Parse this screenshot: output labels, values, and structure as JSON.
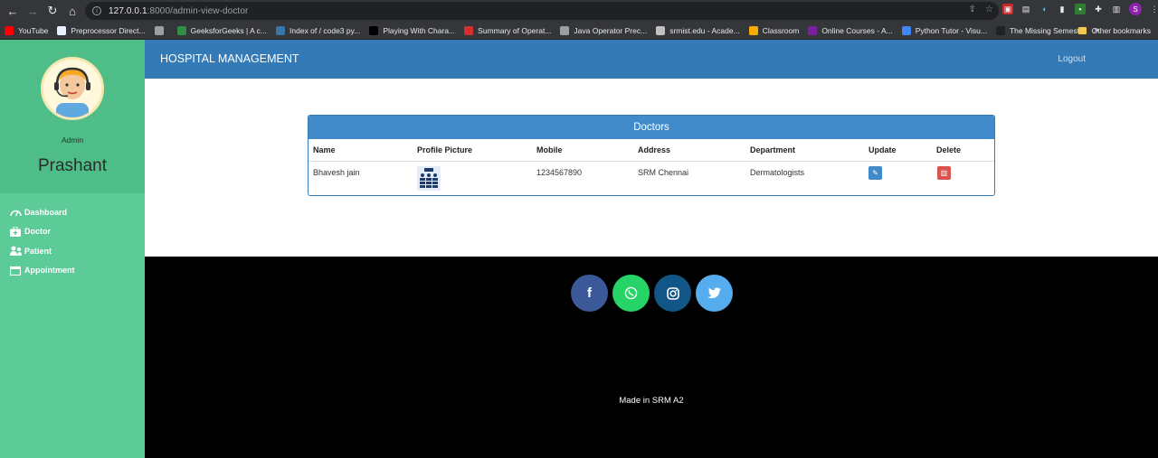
{
  "browser": {
    "url_host": "127.0.0.1",
    "url_path": ":8000/admin-view-doctor",
    "bookmarks": [
      {
        "label": "YouTube",
        "color": "#ff0000"
      },
      {
        "label": "Preprocessor Direct...",
        "color": "#e8f0fe"
      },
      {
        "label": "",
        "color": "#9aa0a6"
      },
      {
        "label": "GeeksforGeeks | A c...",
        "color": "#2f8d46"
      },
      {
        "label": "Index of / code3 py...",
        "color": "#3776ab"
      },
      {
        "label": "Playing With Chara...",
        "color": "#000000"
      },
      {
        "label": "Summary of Operat...",
        "color": "#d32f2f"
      },
      {
        "label": "Java Operator Prec...",
        "color": "#9aa0a6"
      },
      {
        "label": "srmist.edu - Acade...",
        "color": "#c0c0c0"
      },
      {
        "label": "Classroom",
        "color": "#f9ab00"
      },
      {
        "label": "Online Courses - A...",
        "color": "#7b1fa2"
      },
      {
        "label": "Python Tutor - Visu...",
        "color": "#4285f4"
      },
      {
        "label": "The Missing Semest...",
        "color": "#202124"
      }
    ],
    "other_bookmarks": "Other bookmarks",
    "profile_initial": "S"
  },
  "sidebar": {
    "role": "Admin",
    "user_name": "Prashant",
    "items": [
      {
        "label": "Dashboard"
      },
      {
        "label": "Doctor"
      },
      {
        "label": "Patient"
      },
      {
        "label": "Appointment"
      }
    ]
  },
  "header": {
    "brand": "HOSPITAL MANAGEMENT",
    "logout": "Logout"
  },
  "panel": {
    "title": "Doctors",
    "columns": [
      "Name",
      "Profile Picture",
      "Mobile",
      "Address",
      "Department",
      "Update",
      "Delete"
    ],
    "rows": [
      {
        "name": "Bhavesh jain",
        "mobile": "1234567890",
        "address": "SRM Chennai",
        "department": "Dermatologists"
      }
    ]
  },
  "footer": {
    "socials": [
      {
        "name": "facebook",
        "glyph": "f",
        "color": "#3b5998"
      },
      {
        "name": "whatsapp",
        "glyph": "✆",
        "color": "#25d366"
      },
      {
        "name": "instagram",
        "glyph": "◎",
        "color": "#125688"
      },
      {
        "name": "twitter",
        "glyph": "🐦",
        "color": "#55acee"
      }
    ],
    "made_in": "Made in SRM A2"
  }
}
